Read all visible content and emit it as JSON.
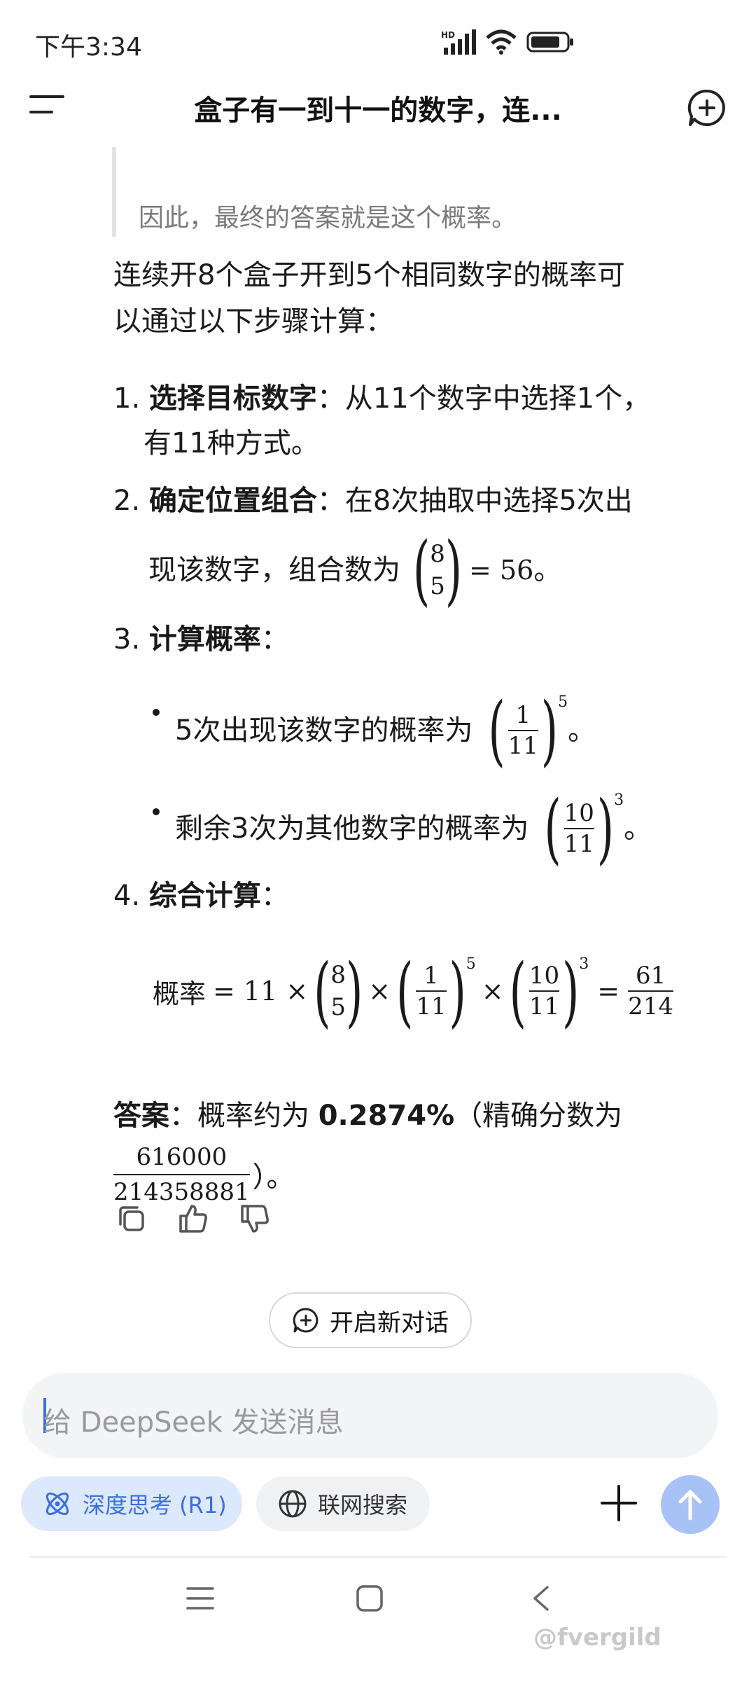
{
  "status": {
    "time": "下午3:34",
    "network_label": "HD"
  },
  "header": {
    "title": "盒子有一到十一的数字，连..."
  },
  "message": {
    "quote_text": "因此，最终的答案就是这个概率。",
    "intro_line1": "连续开8个盒子开到5个相同数字的概率可",
    "intro_line2": "以通过以下步骤计算：",
    "steps": [
      {
        "num": "1.",
        "title": "选择目标数字",
        "text1": "：从11个数字中选择1个，",
        "text2": "有11种方式。"
      },
      {
        "num": "2.",
        "title": "确定位置组合",
        "text1": "：在8次抽取中选择5次出",
        "text2": "现该数字，组合数为",
        "binom_n": "8",
        "binom_k": "5",
        "eq": "= 56",
        "end": "。"
      },
      {
        "num": "3.",
        "title": "计算概率",
        "text1": "：",
        "bullets": [
          {
            "text": "5次出现该数字的概率为",
            "num": "1",
            "den": "11",
            "exp": "5",
            "end": "。"
          },
          {
            "text": "剩余3次为其他数字的概率为",
            "num": "10",
            "den": "11",
            "exp": "3",
            "end": "。"
          }
        ]
      },
      {
        "num": "4.",
        "title": "综合计算",
        "text1": "：",
        "formula": {
          "lhs": "概率",
          "eq1": "= 11 ×",
          "times": "×",
          "eq2": "=",
          "result_num": "61",
          "result_den": "214"
        }
      }
    ],
    "answer_label": "答案",
    "answer_text": "：概率约为",
    "answer_value": "0.2874%",
    "answer_paren": "（精确分数为",
    "answer_num": "616000",
    "answer_den": "214358881",
    "answer_end": "）。"
  },
  "actions": {
    "new_chat": "开启新对话"
  },
  "input": {
    "placeholder": "给 DeepSeek 发送消息"
  },
  "chips": {
    "deep_think": "深度思考 (R1)",
    "web_search": "联网搜索"
  },
  "watermark": "@fvergild",
  "colors": {
    "accent": "#3b6fe0",
    "chip_bg": "#dce8fb",
    "send_bg": "#a7c3f5"
  }
}
